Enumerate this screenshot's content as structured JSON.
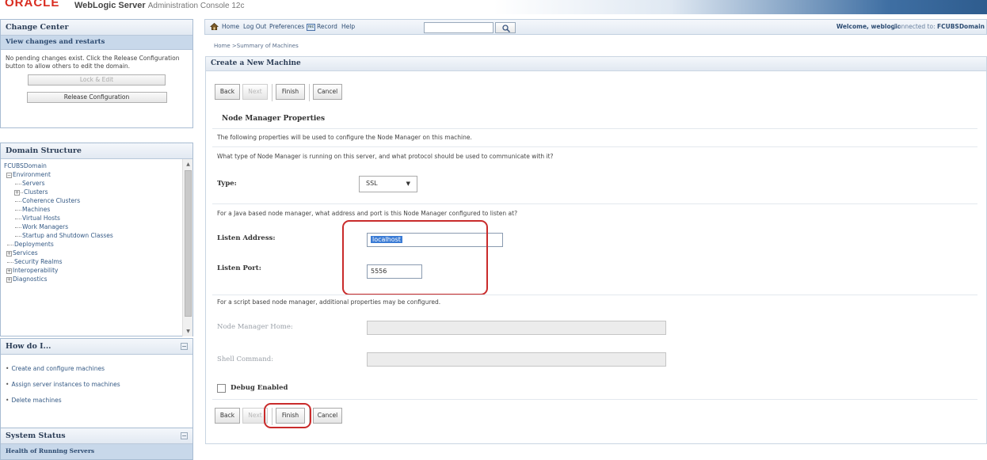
{
  "header": {
    "logo": "ORACLE",
    "product": "WebLogic Server",
    "subtitle": "Administration Console 12c"
  },
  "toolbar": {
    "home": "Home",
    "logout": "Log Out",
    "preferences": "Preferences",
    "record": "Record",
    "help": "Help",
    "search_value": "",
    "welcome": "Welcome, weblogic",
    "connected_label": "Connected to:",
    "domain": "FCUBSDomain"
  },
  "breadcrumb": "Home >Summary of Machines",
  "change_center": {
    "title": "Change Center",
    "subtitle": "View changes and restarts",
    "message": "No pending changes exist. Click the Release Configuration button to allow others to edit the domain.",
    "lock_edit": "Lock & Edit",
    "release_config": "Release Configuration"
  },
  "domain_structure": {
    "title": "Domain Structure",
    "root": "FCUBSDomain",
    "environment": "Environment",
    "servers": "Servers",
    "clusters": "Clusters",
    "coherence_clusters": "Coherence Clusters",
    "machines": "Machines",
    "virtual_hosts": "Virtual Hosts",
    "work_managers": "Work Managers",
    "startup_shutdown": "Startup and Shutdown Classes",
    "deployments": "Deployments",
    "services": "Services",
    "security_realms": "Security Realms",
    "interoperability": "Interoperability",
    "diagnostics": "Diagnostics"
  },
  "how_do_i": {
    "title": "How do I...",
    "items": [
      "Create and configure machines",
      "Assign server instances to machines",
      "Delete machines"
    ]
  },
  "system_status": {
    "title": "System Status",
    "health": "Health of Running Servers"
  },
  "content": {
    "title": "Create a New Machine",
    "back": "Back",
    "next": "Next",
    "finish": "Finish",
    "cancel": "Cancel",
    "section_title": "Node Manager Properties",
    "intro": "The following properties will be used to configure the Node Manager on this machine.",
    "question": "What type of Node Manager is running on this server, and what protocol should be used to communicate with it?",
    "type_label": "Type:",
    "type_value": "SSL",
    "java_question": "For a Java based node manager, what address and port is this Node Manager configured to listen at?",
    "listen_address_label": "Listen Address:",
    "listen_address_value": "localhost",
    "listen_port_label": "Listen Port:",
    "listen_port_value": "5556",
    "script_note": "For a script based node manager, additional properties may be configured.",
    "nm_home_label": "Node Manager Home:",
    "nm_home_value": "",
    "shell_command_label": "Shell Command:",
    "shell_command_value": "",
    "debug_label": "Debug Enabled"
  },
  "colors": {
    "highlight_box": "#c92b2b",
    "oracle_red": "#d92b1f",
    "panel_border": "#a8bcd2"
  }
}
